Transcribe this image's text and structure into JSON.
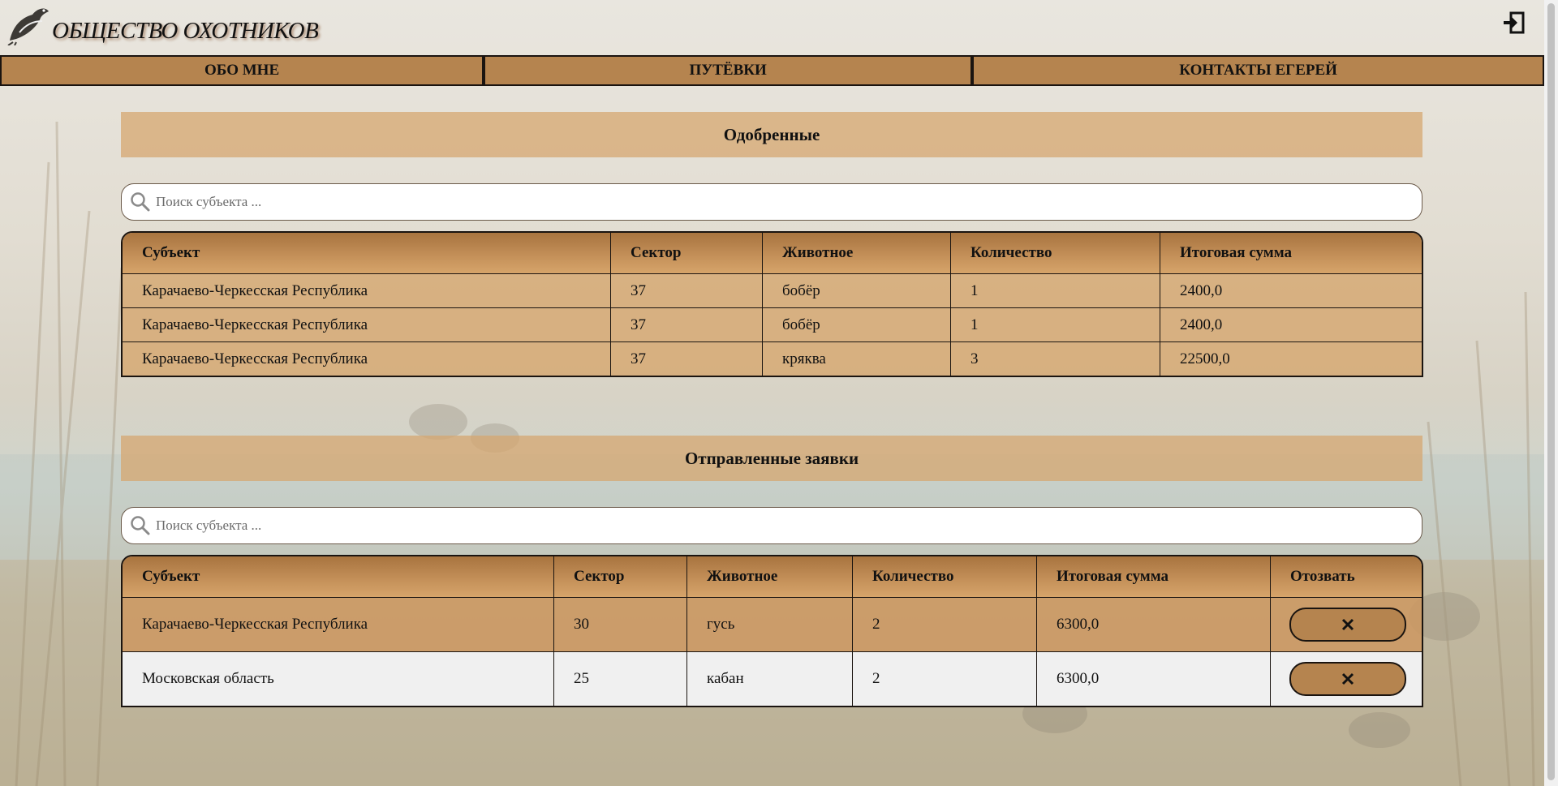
{
  "header": {
    "title": "ОБЩЕСТВО ОХОТНИКОВ"
  },
  "nav": {
    "items": [
      "ОБО МНЕ",
      "ПУТЁВКИ",
      "КОНТАКТЫ ЕГЕРЕЙ"
    ]
  },
  "approved": {
    "title": "Одобренные",
    "search_placeholder": "Поиск субъекта ...",
    "columns": [
      "Субъект",
      "Сектор",
      "Животное",
      "Количество",
      "Итоговая сумма"
    ],
    "rows": [
      [
        "Карачаево-Черкесская Республика",
        "37",
        "бобёр",
        "1",
        "2400,0"
      ],
      [
        "Карачаево-Черкесская Республика",
        "37",
        "бобёр",
        "1",
        "2400,0"
      ],
      [
        "Карачаево-Черкесская Республика",
        "37",
        "кряква",
        "3",
        "22500,0"
      ]
    ]
  },
  "sent": {
    "title": "Отправленные заявки",
    "search_placeholder": "Поиск субъекта ...",
    "columns": [
      "Субъект",
      "Сектор",
      "Животное",
      "Количество",
      "Итоговая сумма",
      "Отозвать"
    ],
    "rows": [
      [
        "Карачаево-Черкесская Республика",
        "30",
        "гусь",
        "2",
        "6300,0"
      ],
      [
        "Московская область",
        "25",
        "кабан",
        "2",
        "6300,0"
      ]
    ]
  },
  "icons": {
    "logo": "duck-logo-icon",
    "logout": "logout-icon",
    "search": "search-icon",
    "revoke": "close-icon"
  },
  "colors": {
    "accent": "#b5844f",
    "section_bg": "#d6a770",
    "border": "#1a1410"
  }
}
